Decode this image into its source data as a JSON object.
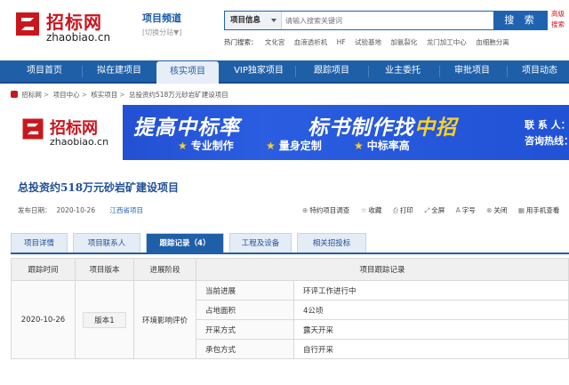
{
  "header": {
    "logo_cn": "招标网",
    "logo_en": "zhaobiao.cn",
    "channel_title": "项目频道",
    "channel_switch": "[切换分站▼]",
    "search_category": "项目信息",
    "search_placeholder": "请输入搜索关键词",
    "search_button": "搜 索",
    "login_hint": "高级搜索",
    "hot_label": "热门搜索：",
    "hot_terms": [
      "文化宫",
      "血液透析机",
      "HF",
      "试验基地",
      "加氨裂化",
      "龙门加工中心",
      "血细胞分离"
    ]
  },
  "nav": {
    "items": [
      "项目首页",
      "拟在建项目",
      "核实项目",
      "VIP独家项目",
      "跟踪项目",
      "业主委托",
      "审批项目",
      "项目动态"
    ],
    "active_index": 2
  },
  "breadcrumb": [
    "招标网",
    "项目中心",
    "核实项目",
    "总投资约518万元砂岩矿建设项目"
  ],
  "banner": {
    "logo_cn": "招标网",
    "logo_en": "zhaobiao.cn",
    "slogan1": "提高中标率",
    "slogan2_pre": "标书制作找",
    "slogan2_hl": "中招",
    "features": [
      "专业制作",
      "量身定制",
      "中标率高"
    ],
    "contact_label": "联 系 人：",
    "phone_label": "咨询热线："
  },
  "project": {
    "title": "总投资约518万元砂岩矿建设项目",
    "publish_label": "发布日期：",
    "publish_date": "2020-10-26",
    "region": "江西省项目"
  },
  "actions": [
    "特约项目调查",
    "收藏",
    "打印",
    "全屏",
    "字号",
    "关闭",
    "用手机查看"
  ],
  "tabs": {
    "items": [
      "项目详情",
      "项目联系人",
      "跟踪记录（4）",
      "工程及设备",
      "相关招投标"
    ],
    "active_index": 2
  },
  "table": {
    "headers": [
      "跟踪时间",
      "项目版本",
      "进展阶段",
      "项目跟踪记录"
    ],
    "track_date": "2020-10-26",
    "version": "版本1",
    "stage": "环境影响评价",
    "rows": [
      {
        "key": "当前进展",
        "value": "环评工作进行中"
      },
      {
        "key": "占地面积",
        "value": "4公顷"
      },
      {
        "key": "开采方式",
        "value": "露天开采"
      },
      {
        "key": "承包方式",
        "value": "自行开采"
      }
    ]
  },
  "colors": {
    "brand_red": "#c8161d",
    "nav_blue": "#1f5fa8",
    "banner_blue": "#2152d6",
    "highlight_yellow": "#ffd21e"
  }
}
